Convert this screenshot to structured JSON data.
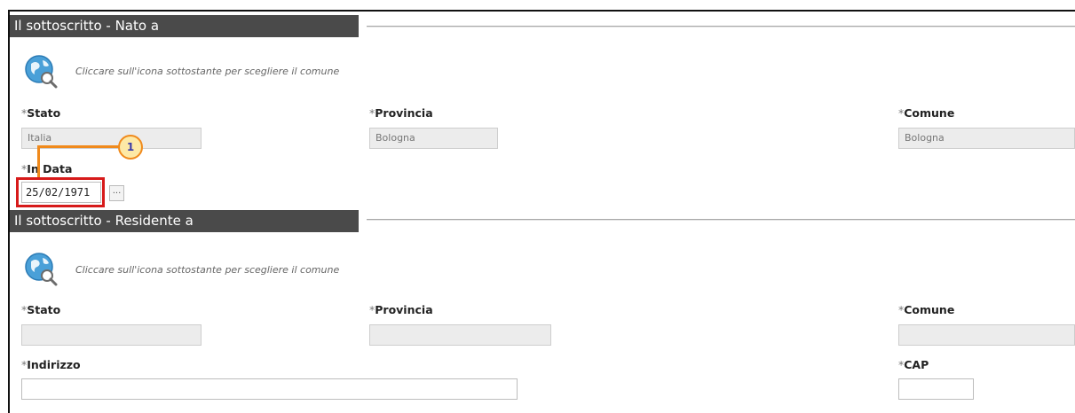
{
  "nato": {
    "title": "Il sottoscritto - Nato a",
    "hint": "Cliccare sull'icona sottostante per scegliere il comune",
    "stato_label": "Stato",
    "stato_value": "Italia",
    "provincia_label": "Provincia",
    "provincia_value": "Bologna",
    "comune_label": "Comune",
    "comune_value": "Bologna",
    "data_label": "In Data",
    "data_value": "25/02/1971",
    "date_button": "..."
  },
  "residente": {
    "title": "Il sottoscritto - Residente a",
    "hint": "Cliccare sull'icona sottostante per scegliere il comune",
    "stato_label": "Stato",
    "stato_value": "",
    "provincia_label": "Provincia",
    "provincia_value": "",
    "comune_label": "Comune",
    "comune_value": "",
    "indirizzo_label": "Indirizzo",
    "indirizzo_value": "",
    "cap_label": "CAP",
    "cap_value": ""
  },
  "required_marker": "*",
  "callout": {
    "number": "1"
  },
  "colors": {
    "header_bg": "#4a4a4a",
    "callout_box": "#d71a1a",
    "callout_line": "#f08a1c",
    "callout_badge_bg": "#fde9a6",
    "callout_number": "#3a3aa8"
  },
  "icons": {
    "globe": "globe-search-icon"
  }
}
